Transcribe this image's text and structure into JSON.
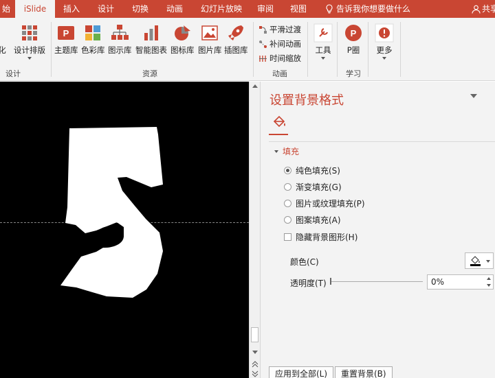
{
  "tabs": [
    {
      "label": "始",
      "active": false
    },
    {
      "label": "iSlide",
      "active": true
    },
    {
      "label": "插入",
      "active": false
    },
    {
      "label": "设计",
      "active": false
    },
    {
      "label": "切换",
      "active": false
    },
    {
      "label": "动画",
      "active": false
    },
    {
      "label": "幻灯片放映",
      "active": false
    },
    {
      "label": "审阅",
      "active": false
    },
    {
      "label": "视图",
      "active": false
    }
  ],
  "tell_me": "告诉我你想要做什么",
  "share": "共享",
  "ribbon": {
    "left_partial": {
      "label1": "化",
      "label2": "设计排版",
      "group": "设计"
    },
    "resources": {
      "buttons": [
        "主题库",
        "色彩库",
        "图示库",
        "智能图表",
        "图标库",
        "图片库",
        "插图库"
      ],
      "group": "资源"
    },
    "animation": {
      "buttons": [
        "平滑过渡",
        "补间动画",
        "时间缩放"
      ],
      "group": "动画"
    },
    "tools": {
      "label": "工具"
    },
    "learn": {
      "label": "P圈",
      "group": "学习"
    },
    "more": {
      "label": "更多"
    }
  },
  "slide": {
    "glyph": "5"
  },
  "pane": {
    "title": "设置背景格式",
    "section": "填充",
    "fill_options": [
      {
        "label": "纯色填充(S)",
        "selected": true
      },
      {
        "label": "渐变填充(G)",
        "selected": false
      },
      {
        "label": "图片或纹理填充(P)",
        "selected": false
      },
      {
        "label": "图案填充(A)",
        "selected": false
      }
    ],
    "hide_bg_graphics": {
      "label": "隐藏背景图形(H)",
      "checked": false
    },
    "color_label": "颜色(C)",
    "transparency_label": "透明度(T)",
    "transparency_value": "0%",
    "apply_all_button": "应用到全部(L)",
    "reset_button": "重置背景(B)"
  },
  "colors": {
    "accent": "#c94633",
    "ribbon_bg": "#f3f3f3",
    "slide_bg": "#000000"
  }
}
